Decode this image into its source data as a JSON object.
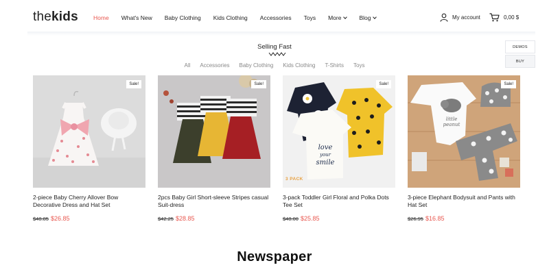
{
  "header": {
    "logo_light": "the",
    "logo_bold": "kids",
    "nav": [
      {
        "label": "Home",
        "active": true
      },
      {
        "label": "What's New"
      },
      {
        "label": "Baby Clothing"
      },
      {
        "label": "Kids Clothing"
      },
      {
        "label": "Accessories"
      },
      {
        "label": "Toys"
      },
      {
        "label": "More",
        "dropdown": true
      },
      {
        "label": "Blog",
        "dropdown": true
      }
    ],
    "account_label": "My account",
    "cart_label": "0,00 $"
  },
  "side_tabs": {
    "demos": "DEMOS",
    "buy": "BUY"
  },
  "section": {
    "title": "Selling Fast",
    "filters": [
      "All",
      "Accessories",
      "Baby Clothing",
      "Kids Clothing",
      "T-Shirts",
      "Toys"
    ]
  },
  "products": [
    {
      "name": "2-piece Baby Cherry Allover Bow Decorative Dress and Hat Set",
      "old_price": "$48.85",
      "price": "$26.85",
      "badge": "Sale!"
    },
    {
      "name": "2pcs Baby Girl Short-sleeve Stripes casual Suit-dress",
      "old_price": "$42.25",
      "price": "$28.85",
      "badge": "Sale!"
    },
    {
      "name": "3-pack Toddler Girl Floral and Polka Dots Tee Set",
      "old_price": "$48.00",
      "price": "$25.85",
      "badge": "Sale!",
      "tag": "3 PACK"
    },
    {
      "name": "3-piece Elephant Bodysuit and Pants with Hat Set",
      "old_price": "$26.95",
      "price": "$16.85",
      "badge": "Sale!"
    }
  ],
  "caption": "Newspaper",
  "colors": {
    "accent": "#e8574f",
    "muted": "#888888"
  }
}
